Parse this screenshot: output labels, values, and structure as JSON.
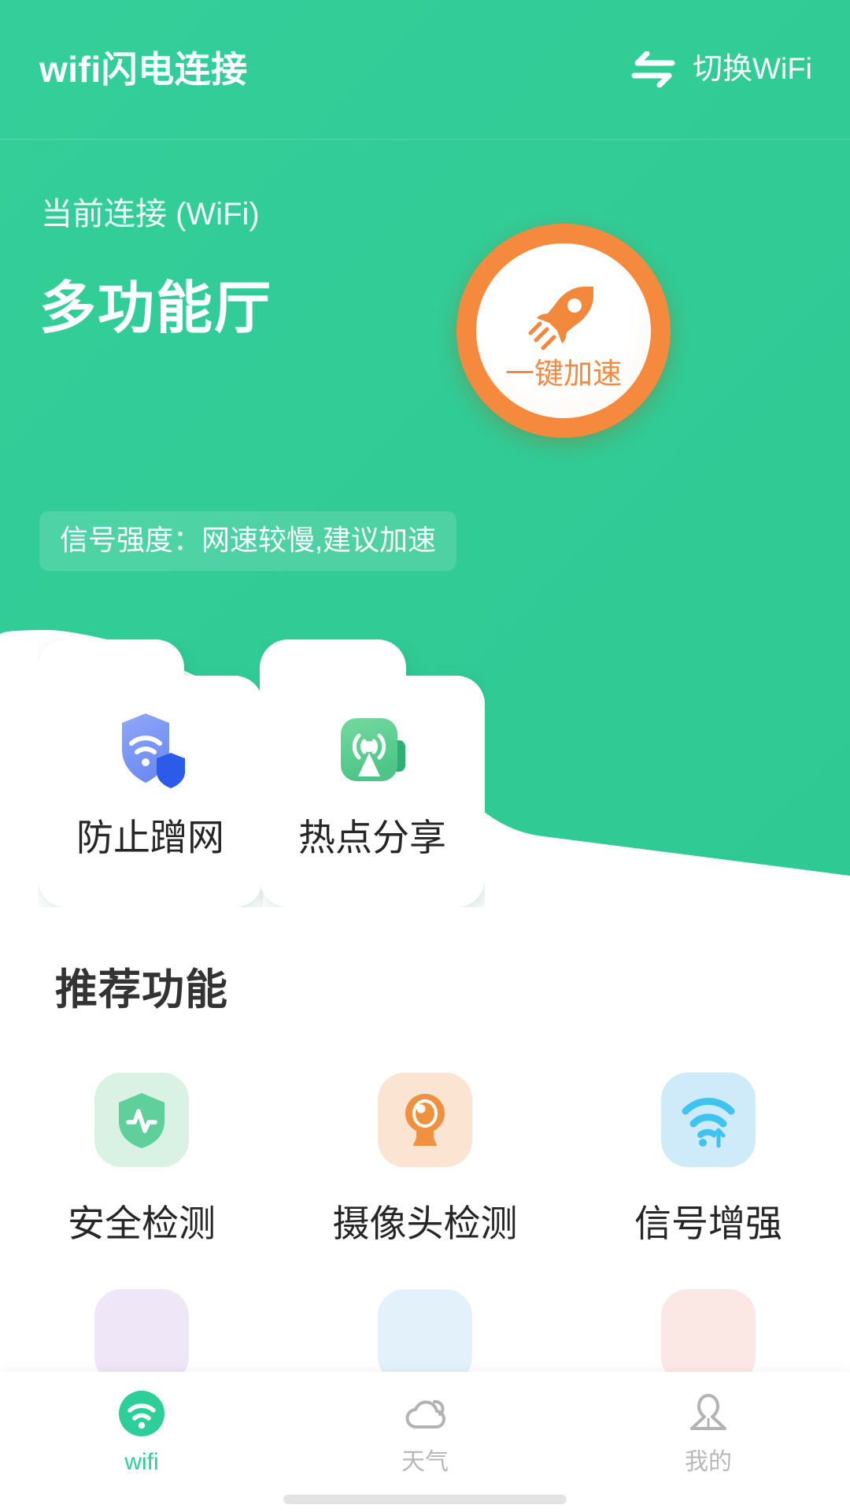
{
  "header": {
    "app_title": "wifi闪电连接",
    "switch_wifi_label": "切换WiFi",
    "swap_icon": "swap-horizontal-icon",
    "background_color": "#33CC99",
    "title_color": "#ffffff"
  },
  "hero": {
    "connected_label": "当前连接 (WiFi)",
    "ssid": "多功能厅",
    "signal_text": "信号强度：网速较慢,建议加速",
    "boost": {
      "label": "一键加速",
      "icon": "rocket-icon",
      "ring_color": "#F5893E",
      "text_color": "#F5893E"
    }
  },
  "quick_cards": [
    {
      "label": "防止蹭网",
      "icon": "shield-wifi-icon",
      "icon_color": "#6E8EF5"
    },
    {
      "label": "热点分享",
      "icon": "hotspot-broadcast-icon",
      "icon_color": "#52C98A"
    }
  ],
  "recommend": {
    "title": "推荐功能",
    "items": [
      {
        "label": "安全检测",
        "icon": "shield-pulse-icon",
        "icon_color": "#5FCF9B",
        "bg_color": "#D9F2E4"
      },
      {
        "label": "摄像头检测",
        "icon": "camera-eye-icon",
        "icon_color": "#F0913F",
        "bg_color": "#FBE5D2"
      },
      {
        "label": "信号增强",
        "icon": "wifi-boost-icon",
        "icon_color": "#3FC3EF",
        "bg_color": "#CFEBFA"
      },
      {
        "label": "",
        "icon": "partial-icon-purple",
        "icon_color": "#9B7FD4",
        "bg_color": "#EFE6F7"
      },
      {
        "label": "",
        "icon": "partial-icon-blue",
        "icon_color": "#5BB8E8",
        "bg_color": "#E2F1FA"
      },
      {
        "label": "",
        "icon": "partial-icon-red",
        "icon_color": "#EE8173",
        "bg_color": "#FBE8E5"
      }
    ]
  },
  "bottom_nav": {
    "active_color": "#2ECE99",
    "inactive_color": "#b8b8b8",
    "items": [
      {
        "label": "wifi",
        "icon": "wifi-icon",
        "active": true
      },
      {
        "label": "天气",
        "icon": "cloud-icon",
        "active": false
      },
      {
        "label": "我的",
        "icon": "person-icon",
        "active": false
      }
    ]
  }
}
